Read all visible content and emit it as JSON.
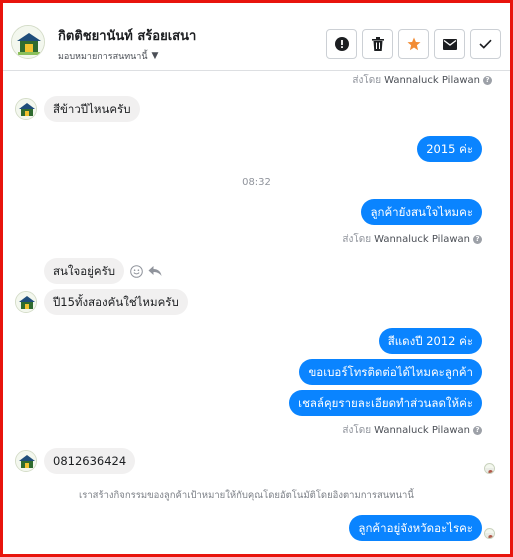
{
  "header": {
    "page_name": "กิตติชยานันท์ สร้อยเสนา",
    "assign_label": "มอบหมายการสนทนานี้",
    "actions": [
      {
        "name": "report-button",
        "icon": "alert-icon"
      },
      {
        "name": "delete-button",
        "icon": "trash-icon"
      },
      {
        "name": "star-button",
        "icon": "star-icon",
        "color": "#f28b33"
      },
      {
        "name": "mail-button",
        "icon": "mail-icon"
      },
      {
        "name": "done-button",
        "icon": "check-icon"
      }
    ]
  },
  "colors": {
    "outgoing": "#0a84ff",
    "incoming": "#f1f0f0",
    "frame": "#e8140d"
  },
  "messages": {
    "top_sent_by": {
      "prefix": "ส่งโดย",
      "name": "Wannaluck Pilawan"
    },
    "m1": "สีข้าวปีไหนครับ",
    "m2": "2015 ค่ะ",
    "time1": "08:32",
    "m3": "ลูกค้ายังสนใจไหมคะ",
    "sent_by_1": {
      "prefix": "ส่งโดย",
      "name": "Wannaluck Pilawan"
    },
    "m4": "สนใจอยู่ครับ",
    "m5": "ปี15ทั้งสองคันใช่ไหมครับ",
    "m6": "สีแดงปี 2012 ค่ะ",
    "m7": "ขอเบอร์โทรติดต่อได้ไหมคะลูกค้า",
    "m8": "เชลล์คุยรายละเอียดทำส่วนลดให้ค่ะ",
    "sent_by_2": {
      "prefix": "ส่งโดย",
      "name": "Wannaluck Pilawan"
    },
    "m9": "0812636424",
    "notice": "เราสร้างกิจกรรมของลูกค้าเป้าหมายให้กับคุณโดยอัตโนมัติโดยอิงตามการสนทนานี้",
    "m10": "ลูกค้าอยู่จังหวัดอะไรคะ"
  }
}
